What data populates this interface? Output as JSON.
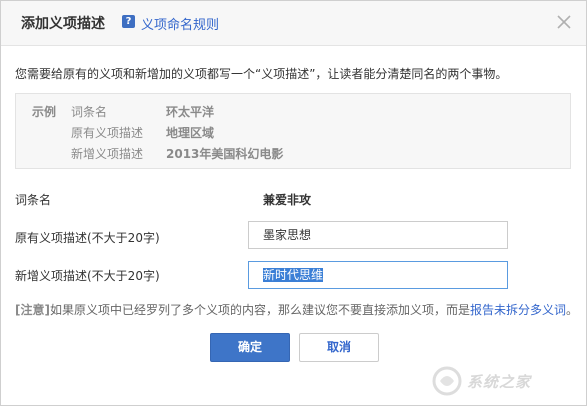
{
  "dialog": {
    "title": "添加义项描述",
    "help_icon": "question-icon",
    "help_link": "义项命名规则",
    "close_icon": "close-icon"
  },
  "intro": "您需要给原有的义项和新增加的义项都写一个“义项描述”，让读者能分清楚同名的两个事物。",
  "example": {
    "title": "示例",
    "rows": [
      {
        "label": "词条名",
        "value": "环太平洋"
      },
      {
        "label": "原有义项描述",
        "value": "地理区域"
      },
      {
        "label": "新增义项描述",
        "value": "2013年美国科幻电影"
      }
    ]
  },
  "form": {
    "entry_label": "词条名",
    "entry_name": "兼爱非攻",
    "original_label": "原有义项描述(不大于20字)",
    "original_value": "墨家思想",
    "new_label": "新增义项描述(不大于20字)",
    "new_value": "新时代思维"
  },
  "note": {
    "tag": "[注意]",
    "text": "如果原义项中已经罗列了多个义项的内容，那么建议您不要直接添加义项，而是",
    "link": "报告未拆分多义词",
    "end": "。"
  },
  "buttons": {
    "ok": "确定",
    "cancel": "取消"
  },
  "watermark": {
    "text": "系统之家"
  },
  "colors": {
    "accent": "#3e75c8",
    "link": "#3366cc",
    "selection": "#3b7fd6"
  }
}
